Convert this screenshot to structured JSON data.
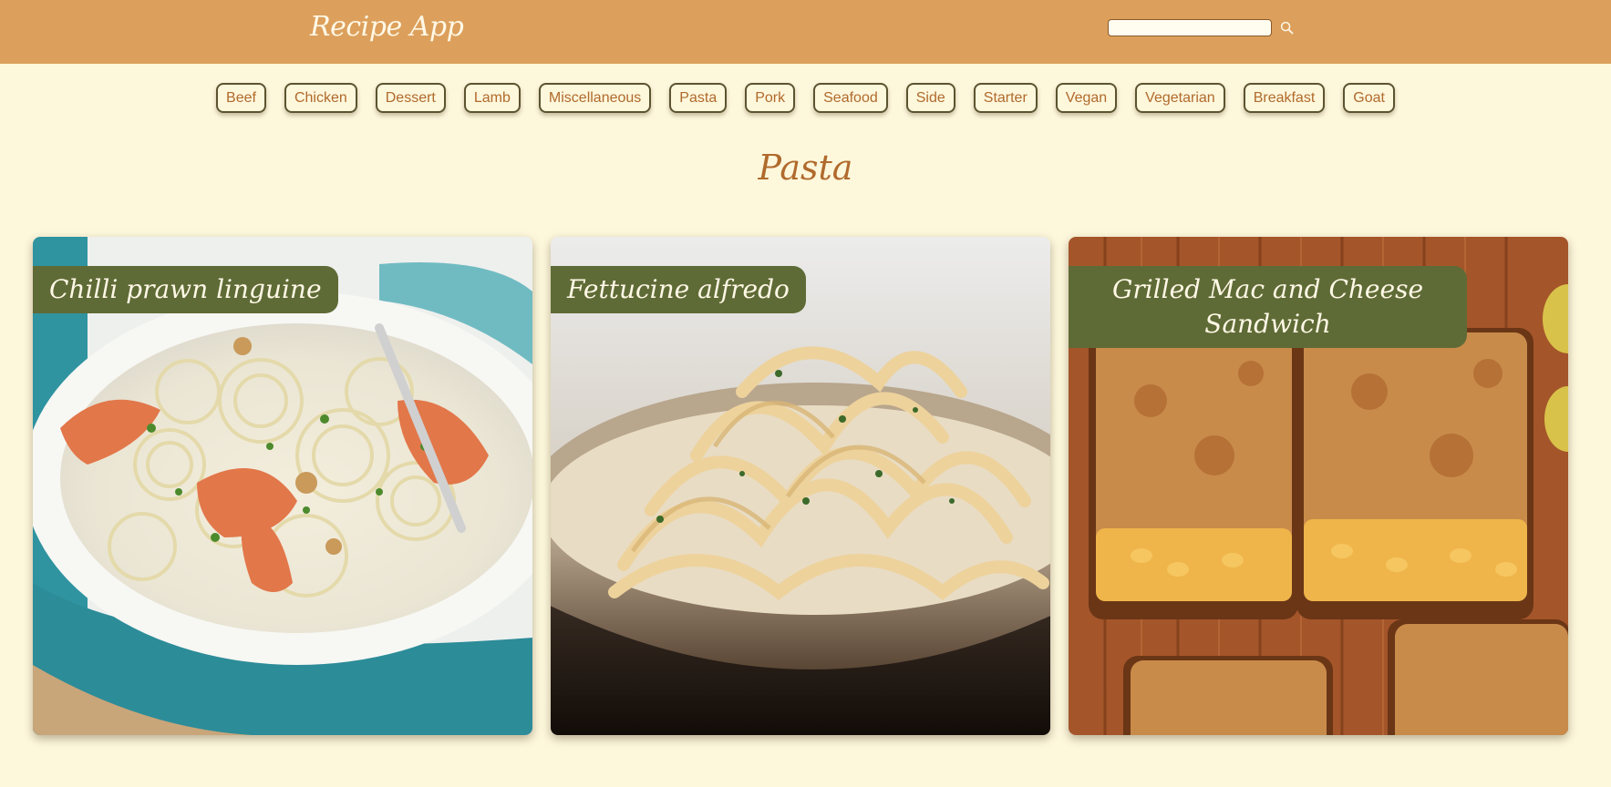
{
  "header": {
    "title": "Recipe App",
    "search": {
      "value": "",
      "placeholder": "",
      "icon": "search-icon"
    }
  },
  "categories": [
    "Beef",
    "Chicken",
    "Dessert",
    "Lamb",
    "Miscellaneous",
    "Pasta",
    "Pork",
    "Seafood",
    "Side",
    "Starter",
    "Vegan",
    "Vegetarian",
    "Breakfast",
    "Goat"
  ],
  "section": {
    "title": "Pasta"
  },
  "meals": [
    {
      "name": "Chilli prawn linguine"
    },
    {
      "name": "Fettucine alfredo"
    },
    {
      "name": "Grilled Mac and Cheese Sandwich"
    }
  ],
  "colors": {
    "header_bg": "#dca05c",
    "page_bg": "#fdf7dc",
    "accent_text": "#b06a2c",
    "label_bg": "#5f6b36"
  }
}
